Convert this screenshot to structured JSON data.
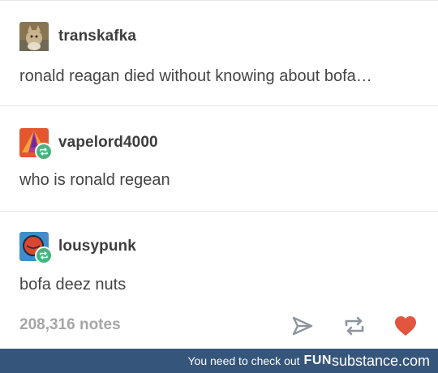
{
  "posts": [
    {
      "username": "transkafka",
      "text": "ronald reagan died without knowing about bofa…",
      "avatar": "cat-photo"
    },
    {
      "username": "vapelord4000",
      "text": "who is ronald regean",
      "avatar": "triangle-art"
    },
    {
      "username": "lousypunk",
      "text": "bofa deez nuts",
      "avatar": "red-circle-art"
    }
  ],
  "footer": {
    "notes": "208,316 notes"
  },
  "banner": {
    "prefix": "You need to check out",
    "brand_part1": "FUN",
    "brand_part2": "substance.com"
  },
  "colors": {
    "reblog_green": "#46b57d",
    "heart": "#e2553f",
    "banner": "#36557a",
    "icon_gray": "#8e959e"
  }
}
